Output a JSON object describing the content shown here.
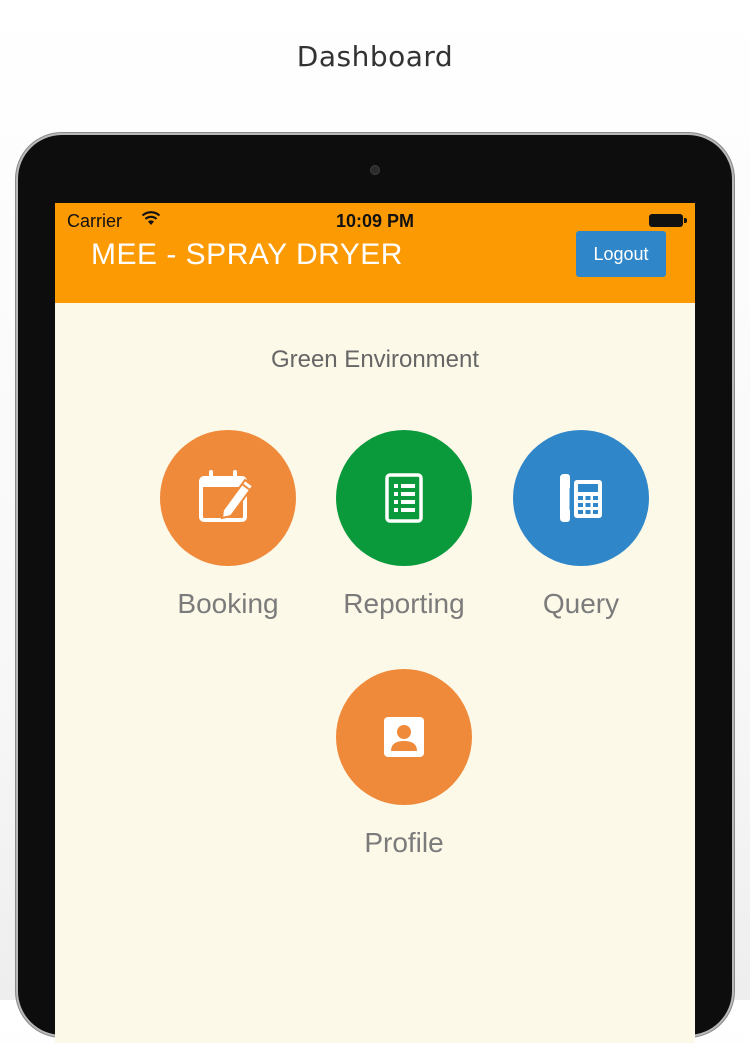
{
  "caption": "Dashboard",
  "status_bar": {
    "carrier": "Carrier",
    "time": "10:09 PM"
  },
  "header": {
    "title": "MEE - SPRAY DRYER",
    "logout_label": "Logout"
  },
  "subtitle": "Green Environment",
  "menu": [
    {
      "label": "Booking",
      "icon": "calendar-edit-icon",
      "color": "#ef8a3b"
    },
    {
      "label": "Reporting",
      "icon": "report-list-icon",
      "color": "#0a9a3c"
    },
    {
      "label": "Query",
      "icon": "phone-icon",
      "color": "#2f86c9"
    },
    {
      "label": "Profile",
      "icon": "profile-card-icon",
      "color": "#ef8a3b"
    }
  ],
  "colors": {
    "header": "#fc9a04",
    "background": "#fdf9e8",
    "logout": "#2f86c9"
  }
}
